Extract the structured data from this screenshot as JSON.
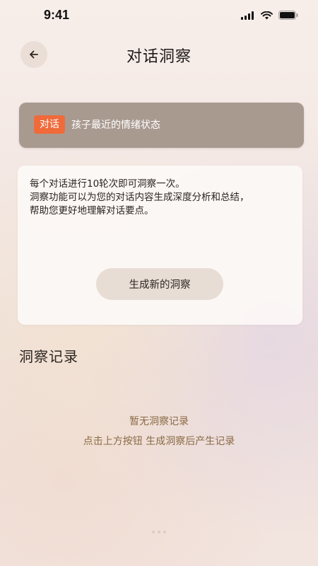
{
  "status_bar": {
    "time": "9:41"
  },
  "header": {
    "back_icon": "back-arrow-icon",
    "title": "对话洞察"
  },
  "banner": {
    "tag": "对话",
    "text": "孩子最近的情绪状态",
    "tag_color": "#f06a3a",
    "background_color": "#a99a90"
  },
  "info_card": {
    "lines": [
      "每个对话进行10轮次即可洞察一次。",
      "洞察功能可以为您的对话内容生成深度分析和总结，",
      "帮助您更好地理解对话要点。"
    ],
    "button_label": "生成新的洞察"
  },
  "records": {
    "title": "洞察记录",
    "empty_title": "暂无洞察记录",
    "empty_hint": "点击上方按钮 生成洞察后产生记录",
    "text_color": "#8a6a45"
  }
}
